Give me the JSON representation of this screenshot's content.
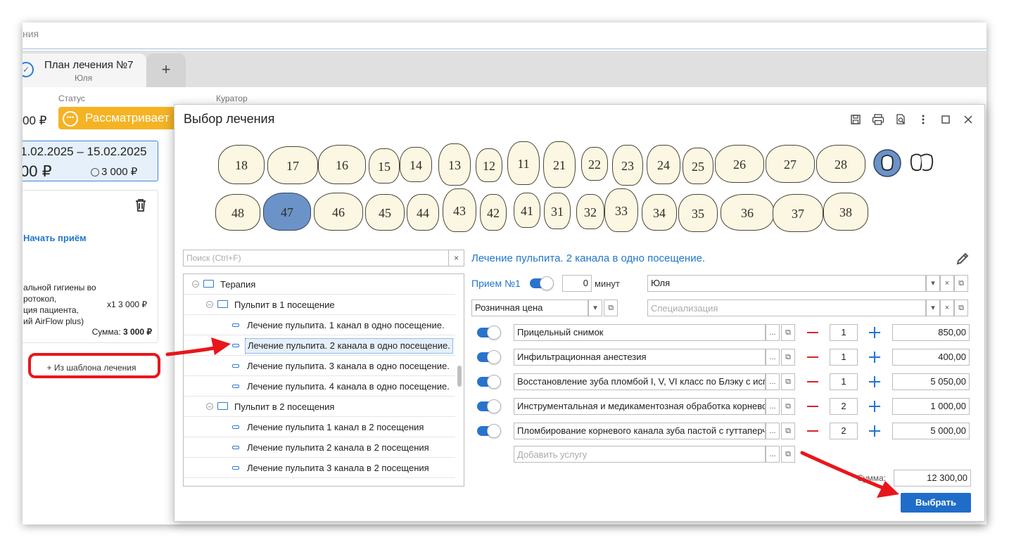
{
  "background": {
    "header_title": "ния",
    "plan_tab": {
      "title": "План лечения №7",
      "subtitle": "Юля"
    },
    "add_tab_label": "+",
    "status_label": "Статус",
    "curator_label": "Куратор",
    "price": "00 ₽",
    "status_badge": "Рассматривает",
    "period": {
      "dates": "1.02.2025 – 15.02.2025",
      "amount": "00 ₽",
      "paid": "3 000 ₽"
    },
    "visit_card": {
      "start_visit": "Начать приём",
      "service_desc": "альной гигиены во\nротокол,\nция пациента,\nий AirFlow plus)",
      "qty": "x1  3 000 ₽",
      "sum_label": "Сумма:",
      "sum_value": "3 000 ₽"
    },
    "template_button": "+ Из шаблона лечения"
  },
  "modal": {
    "title": "Выбор лечения",
    "tools": [
      "save-icon",
      "print-icon",
      "preview-icon",
      "more-icon",
      "maximize-icon",
      "close-icon"
    ],
    "teeth_upper": [
      "18",
      "17",
      "16",
      "15",
      "14",
      "13",
      "12",
      "11",
      "21",
      "22",
      "23",
      "24",
      "25",
      "26",
      "27",
      "28"
    ],
    "teeth_lower": [
      "48",
      "47",
      "46",
      "45",
      "44",
      "43",
      "42",
      "41",
      "31",
      "32",
      "33",
      "34",
      "35",
      "36",
      "37",
      "38"
    ],
    "selected_tooth": "47",
    "search_placeholder": "Поиск (Ctrl+F)",
    "tree": [
      {
        "label": "Терапия",
        "type": "folder"
      },
      {
        "label": "Пульпит в 1 посещение",
        "type": "folder"
      },
      {
        "label": "Лечение пульпита. 1 канал в одно посещение.",
        "type": "item"
      },
      {
        "label": "Лечение пульпита. 2 канала в одно посещение.",
        "type": "item",
        "selected": true
      },
      {
        "label": "Лечение пульпита. 3 канала в одно посещение.",
        "type": "item"
      },
      {
        "label": "Лечение пульпита. 4 канала в одно посещение.",
        "type": "item"
      },
      {
        "label": "Пульпит в 2 посещения",
        "type": "folder"
      },
      {
        "label": "Лечение пульпита 1 канал в 2 посещения",
        "type": "item"
      },
      {
        "label": "Лечение пульпита 2 канала в 2 посещения",
        "type": "item"
      },
      {
        "label": "Лечение пульпита 3 канала в 2 посещения",
        "type": "item"
      }
    ],
    "selected_title": "Лечение пульпита. 2 канала в одно посещение.",
    "visit": {
      "label": "Прием №1",
      "minutes": "0",
      "minutes_unit": "минут",
      "doctor": "Юля"
    },
    "price_type": "Розничная цена",
    "specialization_placeholder": "Специализация",
    "services": [
      {
        "name": "Прицельный снимок",
        "qty": "1",
        "price": "850,00"
      },
      {
        "name": "Инфильтрационная анестезия",
        "qty": "1",
        "price": "400,00"
      },
      {
        "name": "Восстановление зуба пломбой I, V, VI класс по Блэку с использованием",
        "qty": "1",
        "price": "5 050,00"
      },
      {
        "name": "Инструментальная и медикаментозная обработка корневого канала",
        "qty": "2",
        "price": "1 000,00"
      },
      {
        "name": "Пломбирование корневого канала зуба пастой с гуттаперчей",
        "qty": "2",
        "price": "5 000,00"
      }
    ],
    "add_service_placeholder": "Добавить услугу",
    "sum_label": "Сумма:",
    "sum_value": "12 300,00",
    "select_button": "Выбрать"
  },
  "colors": {
    "accent": "#1f6dc9",
    "status": "#f5b324",
    "annotation": "#e8161c",
    "selected_tooth": "#6b93c8"
  }
}
